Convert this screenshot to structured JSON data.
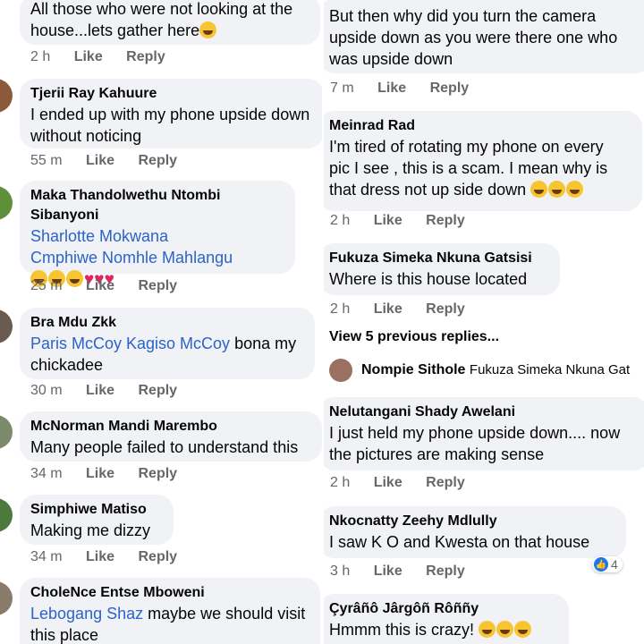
{
  "left": [
    {
      "name": "",
      "lines": [
        "All those who were not looking at the",
        "house...lets gather here"
      ],
      "time": "2 h"
    },
    {
      "name": "Tjerii Ray Kahuure",
      "lines": [
        "I ended up with my phone upside down",
        "without noticing"
      ],
      "time": "55 m"
    },
    {
      "name": "Maka Thandolwethu Ntombi Sibanyoni",
      "mentions": [
        "Sharlotte Mokwana",
        "Cmphiwe Nomhle Mahlangu"
      ],
      "time": "25 m"
    },
    {
      "name": "Bra Mdu  Zkk",
      "mention": "Paris McCoy Kagiso McCoy",
      "lines": [
        " bona my",
        "chickadee"
      ],
      "time": "30 m"
    },
    {
      "name": "McNorman Mandi Marembo",
      "lines": [
        "Many people failed to understand this"
      ],
      "time": "34 m"
    },
    {
      "name": "Simphiwe Matiso",
      "lines": [
        "Making me dizzy"
      ],
      "time": "34 m"
    },
    {
      "name": "CholeNce Entse Mboweni",
      "mention": "Lebogang Shaz",
      "lines": [
        " maybe we should visit",
        "this place"
      ]
    }
  ],
  "right": [
    {
      "name": "",
      "lines": [
        "But then why did you turn the camera",
        "upside down as you were there one who",
        "was upside down"
      ],
      "time": "7 m"
    },
    {
      "name": "Meinrad Rad",
      "lines": [
        "I'm tired of rotating my phone on every",
        "pic I see , this is a scam. I mean why is",
        "that dress not up side down "
      ],
      "time": "2 h"
    },
    {
      "name": "Fukuza Simeka Nkuna Gatsisi",
      "lines": [
        "Where is this house located"
      ],
      "time": "2 h"
    },
    {
      "name": "Nelutangani Shady Awelani",
      "lines": [
        "I just held my phone upside down.... now",
        "the pictures are making sense"
      ],
      "time": "2 h"
    },
    {
      "name": "Nkocnatty Zeehy Mdlully",
      "lines": [
        "I saw K O and Kwesta on that house"
      ],
      "time": "3 h",
      "reaction_count": "4"
    },
    {
      "name": "Çyrâñô Jârgôñ Rôññy",
      "lines": [
        "Hmmm this is crazy! "
      ]
    }
  ],
  "actions": {
    "like": "Like",
    "reply": "Reply"
  },
  "view_replies": "View 5 previous replies...",
  "reply_preview": {
    "name": "Nompie Sithole",
    "mention": "Fukuza Simeka Nkuna Gat"
  }
}
